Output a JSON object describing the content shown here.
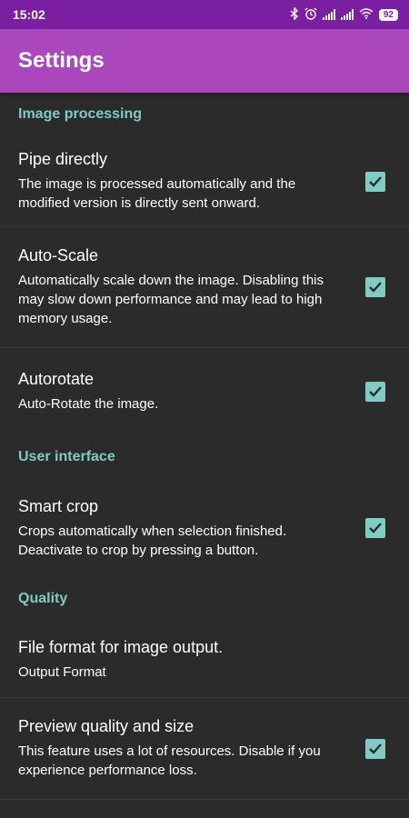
{
  "status_bar": {
    "time": "15:02",
    "battery": "92",
    "icons": [
      "bluetooth-icon",
      "alarm-icon",
      "signal-icon",
      "signal-icon",
      "wifi-icon",
      "battery-icon"
    ]
  },
  "app_bar": {
    "title": "Settings"
  },
  "sections": {
    "image_processing": {
      "header": "Image processing",
      "pipe_directly": {
        "title": "Pipe directly",
        "summary": "The image is processed automatically and the modified version is directly sent onward.",
        "checked": true
      },
      "auto_scale": {
        "title": "Auto-Scale",
        "summary": "Automatically scale down the image. Disabling this may slow down performance and may lead to high memory usage.",
        "checked": true
      },
      "autorotate": {
        "title": "Autorotate",
        "summary": "Auto-Rotate the image.",
        "checked": true
      }
    },
    "user_interface": {
      "header": "User interface",
      "smart_crop": {
        "title": "Smart crop",
        "summary": "Crops automatically when selection finished. Deactivate to crop by pressing a button.",
        "checked": true
      }
    },
    "quality": {
      "header": "Quality",
      "file_format": {
        "title": "File format for image output.",
        "summary": "Output Format"
      },
      "preview_quality": {
        "title": "Preview quality and size",
        "summary": "This feature uses a lot of resources. Disable if you experience performance loss.",
        "checked": true
      }
    }
  },
  "colors": {
    "status_bar": "#7b1fa2",
    "app_bar": "#ab47bc",
    "background": "#2b2b2b",
    "accent": "#80cbc4"
  }
}
